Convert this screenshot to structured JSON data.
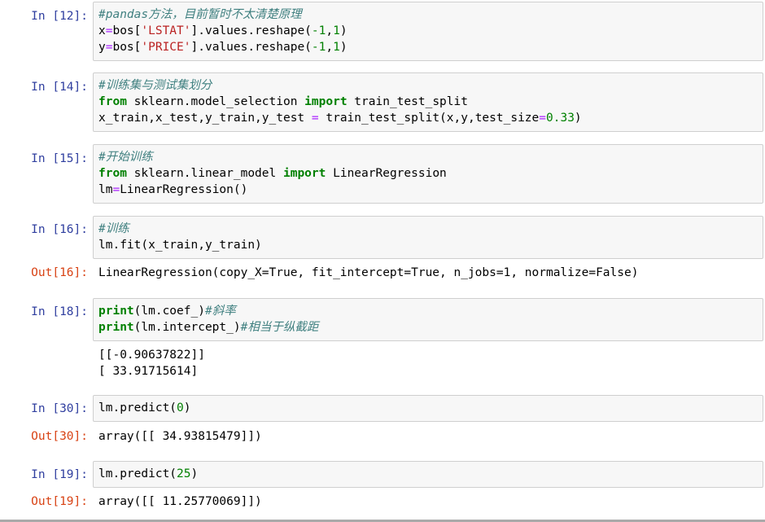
{
  "cells": [
    {
      "in_prompt": "In [12]:",
      "lines": [
        [
          {
            "t": "#pandas方法，目前暂时不太清楚原理",
            "c": "cm"
          }
        ],
        [
          {
            "t": "x",
            "c": ""
          },
          {
            "t": "=",
            "c": "op"
          },
          {
            "t": "bos[",
            "c": ""
          },
          {
            "t": "'LSTAT'",
            "c": "str"
          },
          {
            "t": "].values.reshape(",
            "c": ""
          },
          {
            "t": "-1",
            "c": "num"
          },
          {
            "t": ",",
            "c": ""
          },
          {
            "t": "1",
            "c": "num"
          },
          {
            "t": ")",
            "c": ""
          }
        ],
        [
          {
            "t": "y",
            "c": ""
          },
          {
            "t": "=",
            "c": "op"
          },
          {
            "t": "bos[",
            "c": ""
          },
          {
            "t": "'PRICE'",
            "c": "str"
          },
          {
            "t": "].values.reshape(",
            "c": ""
          },
          {
            "t": "-1",
            "c": "num"
          },
          {
            "t": ",",
            "c": ""
          },
          {
            "t": "1",
            "c": "num"
          },
          {
            "t": ")",
            "c": ""
          }
        ]
      ]
    },
    {
      "in_prompt": "In [14]:",
      "lines": [
        [
          {
            "t": "#训练集与测试集划分",
            "c": "cm"
          }
        ],
        [
          {
            "t": "from",
            "c": "kw"
          },
          {
            "t": " sklearn.model_selection ",
            "c": ""
          },
          {
            "t": "import",
            "c": "kw"
          },
          {
            "t": " train_test_split",
            "c": ""
          }
        ],
        [
          {
            "t": "x_train,x_test,y_train,y_test ",
            "c": ""
          },
          {
            "t": "=",
            "c": "op"
          },
          {
            "t": " train_test_split(x,y,test_size",
            "c": ""
          },
          {
            "t": "=",
            "c": "op"
          },
          {
            "t": "0.33",
            "c": "num"
          },
          {
            "t": ")",
            "c": ""
          }
        ]
      ]
    },
    {
      "in_prompt": "In [15]:",
      "lines": [
        [
          {
            "t": "#开始训练",
            "c": "cm"
          }
        ],
        [
          {
            "t": "from",
            "c": "kw"
          },
          {
            "t": " sklearn.linear_model ",
            "c": ""
          },
          {
            "t": "import",
            "c": "kw"
          },
          {
            "t": " LinearRegression",
            "c": ""
          }
        ],
        [
          {
            "t": "lm",
            "c": ""
          },
          {
            "t": "=",
            "c": "op"
          },
          {
            "t": "LinearRegression()",
            "c": ""
          }
        ]
      ]
    },
    {
      "in_prompt": "In [16]:",
      "lines": [
        [
          {
            "t": "#训练",
            "c": "cm"
          }
        ],
        [
          {
            "t": "lm.fit(x_train,y_train)",
            "c": ""
          }
        ]
      ],
      "out_prompt": "Out[16]:",
      "output": [
        "LinearRegression(copy_X=True, fit_intercept=True, n_jobs=1, normalize=False)"
      ]
    },
    {
      "in_prompt": "In [18]:",
      "lines": [
        [
          {
            "t": "print",
            "c": "kw"
          },
          {
            "t": "(lm.coef_)",
            "c": ""
          },
          {
            "t": "#斜率",
            "c": "cm"
          }
        ],
        [
          {
            "t": "print",
            "c": "kw"
          },
          {
            "t": "(lm.intercept_)",
            "c": ""
          },
          {
            "t": "#相当于纵截距",
            "c": "cm"
          }
        ]
      ],
      "out_prompt": "",
      "output": [
        "[[-0.90637822]]",
        "[ 33.91715614]"
      ]
    },
    {
      "in_prompt": "In [30]:",
      "lines": [
        [
          {
            "t": "lm.predict(",
            "c": ""
          },
          {
            "t": "0",
            "c": "num"
          },
          {
            "t": ")",
            "c": ""
          }
        ]
      ],
      "out_prompt": "Out[30]:",
      "output": [
        "array([[ 34.93815479]])"
      ]
    },
    {
      "in_prompt": "In [19]:",
      "lines": [
        [
          {
            "t": "lm.predict(",
            "c": ""
          },
          {
            "t": "25",
            "c": "num"
          },
          {
            "t": ")",
            "c": ""
          }
        ]
      ],
      "out_prompt": "Out[19]:",
      "output": [
        "array([[ 11.25770069]])"
      ]
    }
  ]
}
